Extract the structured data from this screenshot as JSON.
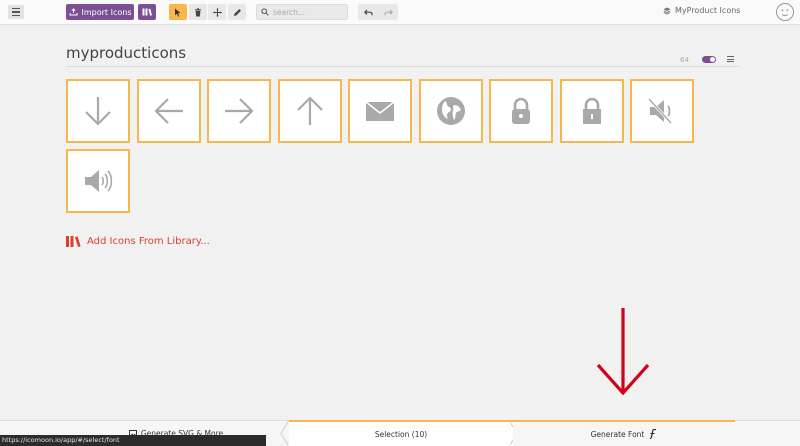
{
  "toolbar": {
    "import_label": "Import Icons",
    "search_placeholder": "search...",
    "project_name": "MyProduct Icons"
  },
  "set": {
    "title": "myproducticons",
    "grid_size": "64",
    "icons": [
      {
        "name": "arrow-down"
      },
      {
        "name": "arrow-left"
      },
      {
        "name": "arrow-right"
      },
      {
        "name": "arrow-up"
      },
      {
        "name": "mail"
      },
      {
        "name": "earth"
      },
      {
        "name": "lock-round"
      },
      {
        "name": "lock"
      },
      {
        "name": "volume-mute"
      },
      {
        "name": "volume-high"
      }
    ]
  },
  "add_library_label": "Add Icons From Library...",
  "bottom": {
    "generate_svg_label": "Generate SVG & More",
    "selection_label": "Selection (10)",
    "generate_font_label": "Generate Font"
  },
  "status_url": "https://icomoon.io/app/#/select/font",
  "colors": {
    "accent": "#f6b84a",
    "brand": "#7b4f92",
    "link": "#d9412e",
    "annotation_arrow": "#d0021b"
  }
}
